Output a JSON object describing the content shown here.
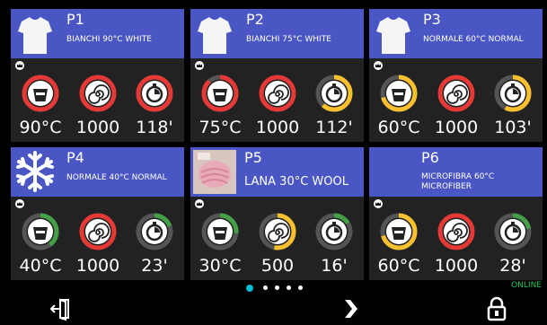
{
  "programs": [
    {
      "name": "P1",
      "desc": "BIANCHI 90°C WHITE",
      "temp": "90°C",
      "spin": "1000",
      "time": "118'",
      "thumb": "shirt-icon",
      "temp_color": "#e53935",
      "timer_color": "#e53935"
    },
    {
      "name": "P2",
      "desc": "BIANCHI 75°C WHITE",
      "temp": "75°C",
      "spin": "1000",
      "time": "112'",
      "thumb": "shirt-icon",
      "temp_color": "#e53935",
      "timer_color": "#fbc02d"
    },
    {
      "name": "P3",
      "desc": "NORMALE 60°C NORMAL",
      "temp": "60°C",
      "spin": "1000",
      "time": "103'",
      "thumb": "shirt-icon",
      "temp_color": "#fbc02d",
      "timer_color": "#fbc02d"
    },
    {
      "name": "P4",
      "desc": "NORMALE 40°C NORMAL",
      "temp": "40°C",
      "spin": "1000",
      "time": "23'",
      "thumb": "snowflake-icon",
      "temp_color": "#43a047",
      "timer_color": "#43a047"
    },
    {
      "name": "P5",
      "desc": "LANA 30°C WOOL",
      "temp": "30°C",
      "spin": "500",
      "time": "16'",
      "thumb": "wool-icon",
      "temp_color": "#43a047",
      "timer_color": "#43a047"
    },
    {
      "name": "P6",
      "desc": "MICROFIBRA 60°C MICROFIBER",
      "temp": "60°C",
      "spin": "1000",
      "time": "28'",
      "thumb": "none",
      "temp_color": "#fbc02d",
      "timer_color": "#43a047"
    }
  ],
  "status": {
    "online_label": "ONLINE"
  },
  "pager": {
    "current_page": 1,
    "page_count": 5
  },
  "colors": {
    "header_bg": "#4a56c4",
    "card_bg": "#222222",
    "spin_color": "#e53935",
    "online_color": "#22c55e",
    "active_dot": "#00bcd4"
  }
}
